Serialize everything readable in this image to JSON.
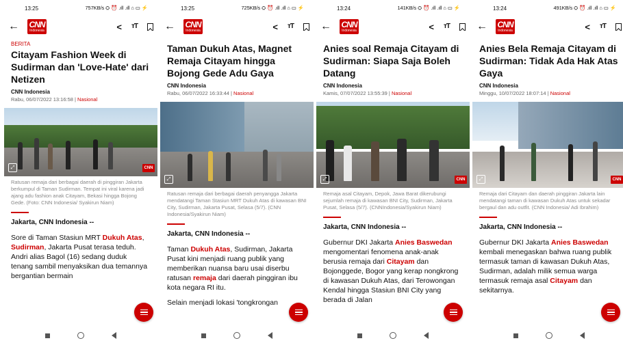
{
  "screens": [
    {
      "status": {
        "time": "13:25",
        "network": "757KB/s ⛭ ⏰ .ıll .ıll ⌂ ▭ ⚡"
      },
      "logo": {
        "big": "CNN",
        "small": "Indonesia"
      },
      "category": "BERITA",
      "headline": "Citayam Fashion Week di Sudirman dan 'Love-Hate' dari Netizen",
      "author": "CNN Indonesia",
      "date": "Rabu, 06/07/2022 13:16:58",
      "section": "Nasional",
      "caption": "Ratusan remaja dari berbagai daerah di pinggiran Jakarta berkumpul di Taman Sudirman. Tempat ini viral karena jadi ajang adu fashion anak Citayam, Bekasi hingga Bojong Gede. (Foto: CNN Indonesia/ Syakirun Niam)",
      "dateline": "Jakarta, CNN Indonesia --",
      "body": [
        {
          "t": "Sore di Taman Stasiun MRT "
        },
        {
          "t": "Dukuh Atas",
          "hl": true
        },
        {
          "t": ", "
        },
        {
          "t": "Sudirman",
          "hl": true
        },
        {
          "t": ", Jakarta Pusat terasa teduh. Andri alias Bagol (16) sedang duduk tenang sambil menyaksikan dua temannya bergantian bermain"
        }
      ],
      "body2": "",
      "watermark": "CNN"
    },
    {
      "status": {
        "time": "13:25",
        "network": "725KB/s ⛭ ⏰ .ıll .ıll ⌂ ▭ ⚡"
      },
      "logo": {
        "big": "CNN",
        "small": "Indonesia"
      },
      "category": "",
      "headline": "Taman Dukuh Atas, Magnet Remaja Citayam hingga Bojong Gede Adu Gaya",
      "author": "CNN Indonesia",
      "date": "Rabu, 06/07/2022 16:33:44",
      "section": "Nasional",
      "caption": "Ratusan remaja dari berbagai daerah penyangga Jakarta mendatangi Taman Stasiun MRT Dukuh Atas di kawasan BNI City, Sudirman, Jakarta Pusat, Selasa (5/7). (CNN Indonesia/Syakirun Niam)",
      "dateline": "Jakarta, CNN Indonesia --",
      "body": [
        {
          "t": "Taman "
        },
        {
          "t": "Dukuh Atas",
          "hl": true
        },
        {
          "t": ", Sudirman, Jakarta Pusat kini menjadi ruang publik yang memberikan nuansa baru usai diserbu ratusan "
        },
        {
          "t": "remaja",
          "hl": true
        },
        {
          "t": " dari daerah pinggiran ibu kota negara RI itu."
        }
      ],
      "body2": "Selain menjadi lokasi 'tongkrongan",
      "watermark": ""
    },
    {
      "status": {
        "time": "13:24",
        "network": "141KB/s ⛭ ⏰ .ıll .ıll ⌂ ▭ ⚡"
      },
      "logo": {
        "big": "CNN",
        "small": "Indonesia"
      },
      "category": "",
      "headline": "Anies soal Remaja Citayam di Sudirman: Siapa Saja Boleh Datang",
      "author": "CNN Indonesia",
      "date": "Kamis, 07/07/2022 13:55:39",
      "section": "Nasional",
      "caption": "Remaja asal Citayam, Depok, Jawa Barat dikerubungi sejumlah remaja di kawasan BNI City, Sudirman, Jakarta Pusat, Selasa (5/7). (CNNIndonesia/Syakirun Niam)",
      "dateline": "Jakarta, CNN Indonesia --",
      "body": [
        {
          "t": "Gubernur DKI Jakarta "
        },
        {
          "t": "Anies Baswedan",
          "hl": true
        },
        {
          "t": " mengomentari fenomena anak-anak berusia remaja dari "
        },
        {
          "t": "Citayam",
          "hl": true
        },
        {
          "t": " dan Bojonggede, Bogor yang kerap nongkrong di kawasan Dukuh Atas, dari Terowongan Kendal hingga Stasiun BNI City yang berada di Jalan"
        }
      ],
      "body2": "",
      "watermark": "CNN"
    },
    {
      "status": {
        "time": "13:24",
        "network": "491KB/s ⛭ ⏰ .ıll .ıll ⌂ ▭ ⚡"
      },
      "logo": {
        "big": "CNN",
        "small": "Indonesia"
      },
      "category": "",
      "headline": "Anies Bela Remaja Citayam di Sudirman: Tidak Ada Hak Atas Gaya",
      "author": "CNN Indonesia",
      "date": "Minggu, 10/07/2022 18:07:14",
      "section": "Nasional",
      "caption": "Remaja dari Citayam dan daerah pinggiran Jakarta lain mendatangi taman di kawasan Dukuh Atas untuk sekadar bergaul dan adu outfit. (CNN Indonesia/ Adi Ibrahim)",
      "dateline": "Jakarta, CNN Indonesia --",
      "body": [
        {
          "t": "Gubernur DKI Jakarta "
        },
        {
          "t": "Anies Baswedan",
          "hl": true
        },
        {
          "t": " kembali menegaskan bahwa ruang publik termasuk taman di kawasan Dukuh Atas, Sudirman, adalah milik semua warga termasuk remaja asal "
        },
        {
          "t": "Citayam",
          "hl": true
        },
        {
          "t": " dan sekitarnya."
        }
      ],
      "body2": "",
      "watermark": "CNN"
    }
  ],
  "toolbar": {
    "back": "←",
    "share": "<",
    "font": "тT"
  },
  "icons": [
    "back-arrow-icon",
    "share-icon",
    "font-size-icon",
    "bookmark-icon",
    "expand-icon",
    "menu-icon"
  ],
  "colors": {
    "accent": "#cc0000",
    "text": "#111111",
    "muted": "#888888"
  }
}
